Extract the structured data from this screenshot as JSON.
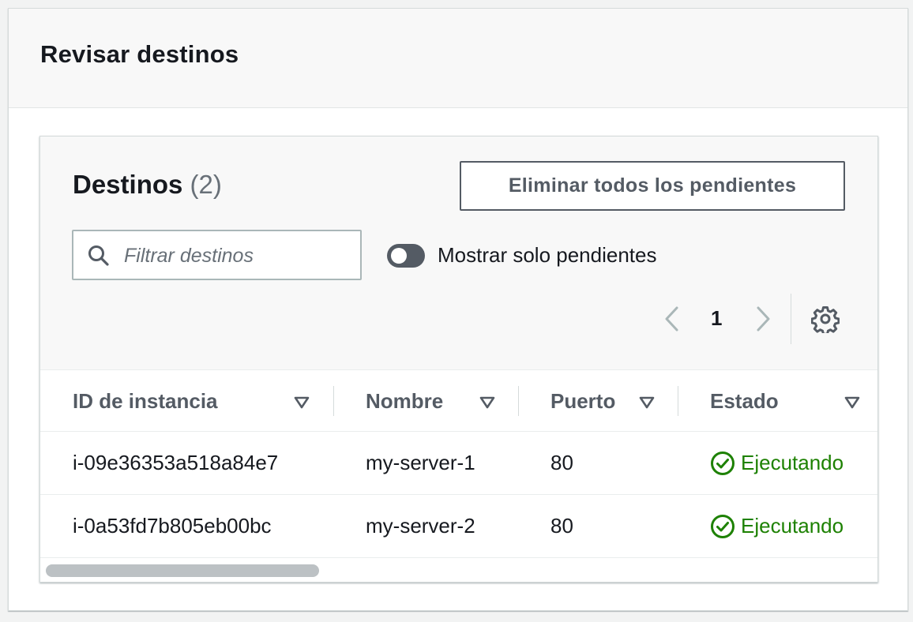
{
  "panel": {
    "title": "Revisar destinos"
  },
  "targets": {
    "title": "Destinos",
    "count": "(2)",
    "remove_button": "Eliminar todos los pendientes",
    "filter_placeholder": "Filtrar destinos",
    "toggle_label": "Mostrar solo pendientes",
    "toggle_on": false,
    "page": "1"
  },
  "table": {
    "columns": [
      "ID de instancia",
      "Nombre",
      "Puerto",
      "Estado"
    ],
    "rows": [
      {
        "id": "i-09e36353a518a84e7",
        "name": "my-server-1",
        "port": "80",
        "status": "Ejecutando"
      },
      {
        "id": "i-0a53fd7b805eb00bc",
        "name": "my-server-2",
        "port": "80",
        "status": "Ejecutando"
      }
    ]
  },
  "colors": {
    "status_ok": "#1d8102",
    "primary_text": "#16191f",
    "muted": "#687078"
  },
  "icons": [
    "search-icon",
    "toggle-switch",
    "chevron-left-icon",
    "chevron-right-icon",
    "gear-icon",
    "sort-down-icon",
    "check-circle-icon"
  ]
}
